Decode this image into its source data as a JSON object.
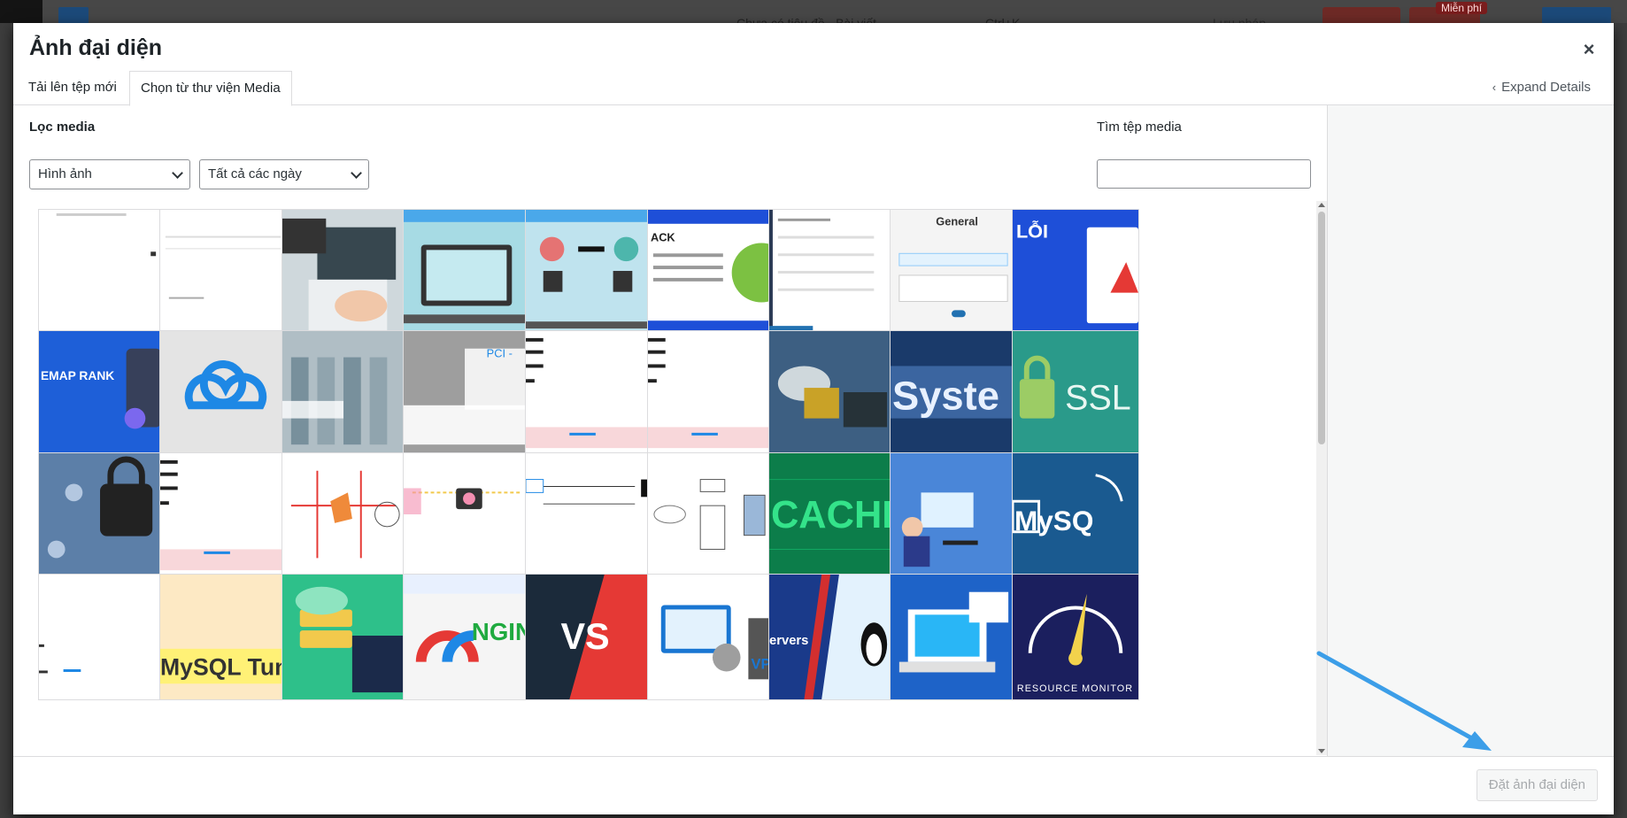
{
  "background_editor": {
    "post_title": "Chưa có tiêu đề - Bài viết",
    "shortcut": "Ctrl+K",
    "save_draft": "Lưu nháp",
    "free_badge": "Miễn phí"
  },
  "modal": {
    "title": "Ảnh đại diện",
    "close_label": "×",
    "tabs": [
      {
        "label": "Tải lên tệp mới"
      },
      {
        "label": "Chọn từ thư viện Media"
      }
    ],
    "expand_details": "Expand Details"
  },
  "filters": {
    "label": "Lọc media",
    "type_selected": "Hình ảnh",
    "date_selected": "Tất cả các ngày"
  },
  "search": {
    "label": "Tìm tệp media",
    "value": ""
  },
  "thumbnails": [
    {
      "name": "blank-screenshot"
    },
    {
      "name": "table-screenshot"
    },
    {
      "name": "laptop-backlinks"
    },
    {
      "name": "pingback-trackback"
    },
    {
      "name": "pingback-link"
    },
    {
      "name": "pingback-wordpress",
      "caption": "ACK"
    },
    {
      "name": "sitemap-settings"
    },
    {
      "name": "general-settings",
      "caption": "General"
    },
    {
      "name": "error-page",
      "caption": "LỖI"
    },
    {
      "name": "sitemap-rank-nginx",
      "caption": "EMAP RANK"
    },
    {
      "name": "cloud-logo"
    },
    {
      "name": "datacenter"
    },
    {
      "name": "pci-dss",
      "caption": "PCI -"
    },
    {
      "name": "robots-headers-1"
    },
    {
      "name": "robots-headers-2"
    },
    {
      "name": "cloud-folder"
    },
    {
      "name": "system-text",
      "caption": "Syste"
    },
    {
      "name": "ssl-certificates",
      "caption": "SSL"
    },
    {
      "name": "security-lock"
    },
    {
      "name": "robots-headers-3"
    },
    {
      "name": "network-diagram"
    },
    {
      "name": "static-snapshot"
    },
    {
      "name": "request-response"
    },
    {
      "name": "web-cache-diagram"
    },
    {
      "name": "cache-text",
      "caption": "CACHE"
    },
    {
      "name": "sql-developer"
    },
    {
      "name": "mysql-dolphin",
      "caption": "MySQ"
    },
    {
      "name": "blank-arrow"
    },
    {
      "name": "mysql-tuner",
      "caption": "MySQL Tune"
    },
    {
      "name": "apache-servers"
    },
    {
      "name": "nginx-gauge",
      "caption": "NGIN"
    },
    {
      "name": "versus",
      "caption": "VS"
    },
    {
      "name": "windows-vps",
      "caption": "VP"
    },
    {
      "name": "linux-servers",
      "caption": "ervers"
    },
    {
      "name": "windows-laptop"
    },
    {
      "name": "resource-monitor",
      "caption": "RESOURCE MONITOR"
    }
  ],
  "toolbar": {
    "set_featured_label": "Đặt ảnh đại diện"
  },
  "colors": {
    "accent": "#2271b1",
    "annotation_arrow": "#3c9ee8"
  }
}
